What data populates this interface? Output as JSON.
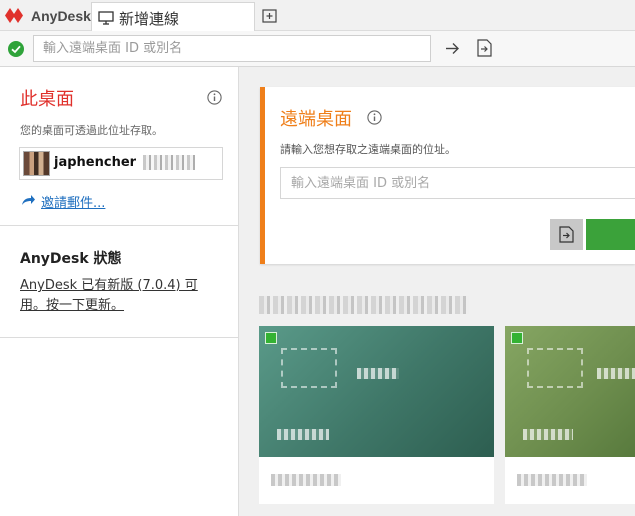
{
  "app": {
    "brand": "AnyDesk"
  },
  "tabs": [
    {
      "label": "新增連線"
    }
  ],
  "addressbar": {
    "placeholder": "輸入遠端桌面 ID 或別名",
    "value": ""
  },
  "this_desk": {
    "title": "此桌面",
    "description": "您的桌面可透過此位址存取。",
    "id_value": "japhencher",
    "invite_label": "邀請郵件..."
  },
  "status": {
    "title": "AnyDesk 狀態",
    "update_text": "AnyDesk 已有新版 (7.0.4) 可用。按一下更新。"
  },
  "remote": {
    "title": "遠端桌面",
    "description": "請輸入您想存取之遠端桌面的位址。",
    "placeholder": "輸入遠端桌面 ID 或別名"
  },
  "colors": {
    "accent": "#ef7f1a",
    "brand": "#e0312c",
    "connect": "#3ba23a",
    "ok": "#2fa33a"
  }
}
